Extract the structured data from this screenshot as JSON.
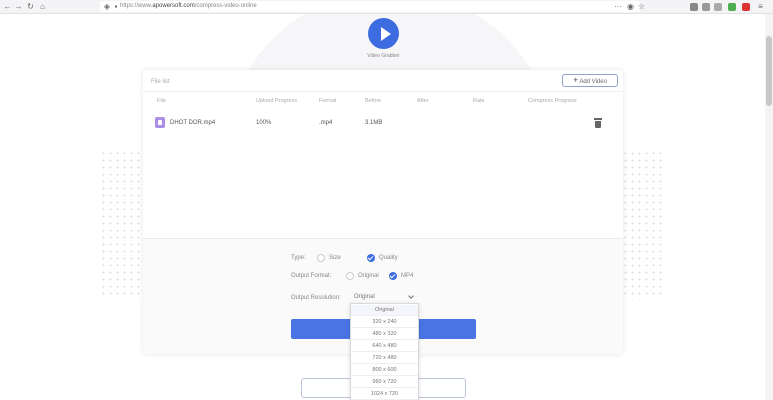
{
  "browser": {
    "url_prefix": "https://www.",
    "url_domain": "apowersoft.com",
    "url_path": "/compress-video-online",
    "nav_back": "←",
    "nav_forward": "→",
    "nav_reload": "↻",
    "nav_home": "⌂",
    "menu_dots": "···"
  },
  "app": {
    "logo_text": "Video Grabber"
  },
  "panel": {
    "section_label": "File list",
    "add_video_label": "Add Video",
    "columns": [
      "File",
      "Upload Progress",
      "Format",
      "Before",
      "After",
      "Rate",
      "Compress Progress"
    ],
    "rows": [
      {
        "file": "DHOT DOR.mp4",
        "upload_progress": "100%",
        "format": ".mp4",
        "before": "3.1MB",
        "after": "",
        "rate": "",
        "compress_progress": ""
      }
    ]
  },
  "settings": {
    "type_label": "Type:",
    "type_options": [
      {
        "label": "Size",
        "checked": false
      },
      {
        "label": "Quality",
        "checked": true
      }
    ],
    "format_label": "Output Format:",
    "format_options": [
      {
        "label": "Original",
        "checked": false
      },
      {
        "label": "MP4",
        "checked": true
      }
    ],
    "resolution_label": "Output Resolution:",
    "resolution_selected": "Original",
    "compress_button": ""
  },
  "dropdown": {
    "options": [
      "Original",
      "320 x 240",
      "480 x 320",
      "640 x 480",
      "720 x 480",
      "800 x 600",
      "960 x 720",
      "1024 x 720"
    ],
    "selected_index": 0
  },
  "colors": {
    "accent": "#3d6be0",
    "button": "#4a74e4",
    "file_icon": "#a98ee6"
  }
}
